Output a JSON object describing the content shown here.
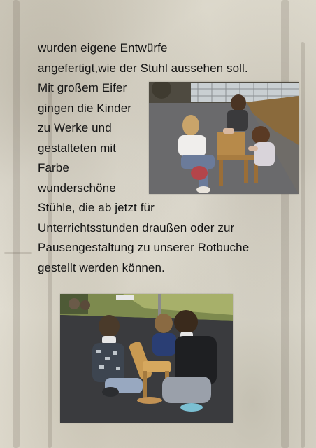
{
  "paragraph_lines": [
    "wurden eigene Entwürfe",
    "angefertigt,wie der Stuhl aussehen soll.",
    "Mit großem Eifer",
    "gingen die Kinder",
    "zu Werke und",
    "gestalteten mit",
    "Farbe",
    "wunderschöne",
    "Stühle, die ab jetzt für",
    "Unterrichtsstunden draußen oder  zur",
    "Pausengestaltung zu unserer  Rotbuche",
    "gestellt  werden können."
  ],
  "colors": {
    "text": "#141414",
    "background": "#e9e6dc"
  },
  "images": [
    {
      "name": "photo-girls-painting-chair",
      "depicts": "girls painting a wooden chair outdoors"
    },
    {
      "name": "photo-boys-painting-chair",
      "depicts": "boys painting a wooden chair outdoors"
    }
  ]
}
